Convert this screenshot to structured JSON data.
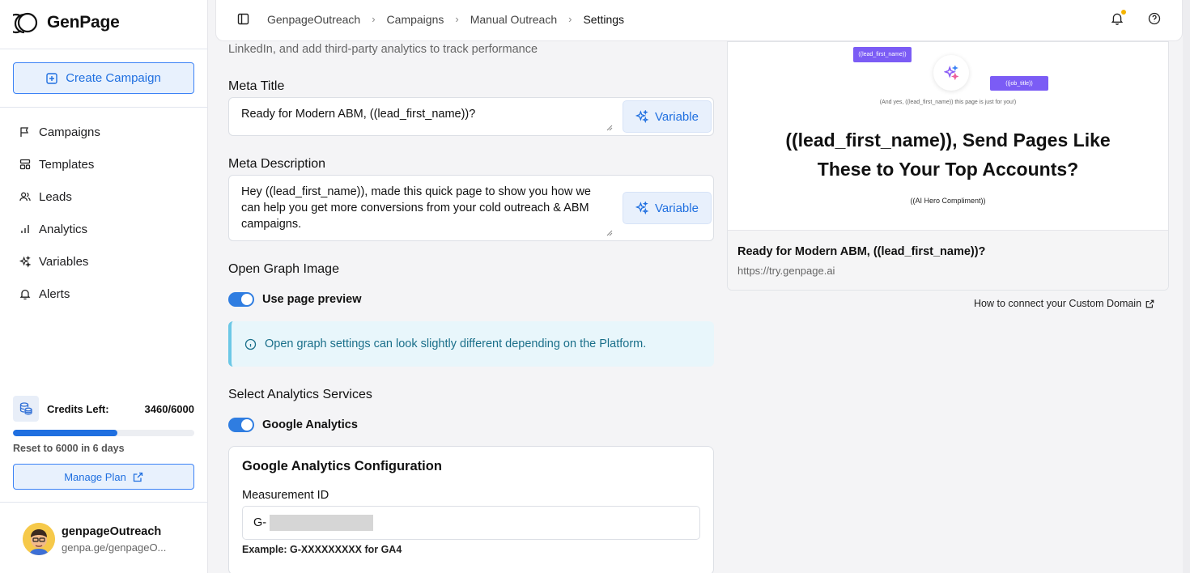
{
  "app": {
    "name": "GenPage"
  },
  "sidebar": {
    "create_label": "Create Campaign",
    "items": [
      {
        "label": "Campaigns",
        "icon": "flag-icon"
      },
      {
        "label": "Templates",
        "icon": "templates-icon"
      },
      {
        "label": "Leads",
        "icon": "users-icon"
      },
      {
        "label": "Analytics",
        "icon": "bar-chart-icon"
      },
      {
        "label": "Variables",
        "icon": "sparkles-icon"
      },
      {
        "label": "Alerts",
        "icon": "bell-icon"
      }
    ],
    "credits": {
      "label": "Credits Left:",
      "value": "3460/6000",
      "fraction": 0.577,
      "reset": "Reset to 6000 in 6 days"
    },
    "manage_label": "Manage Plan",
    "user": {
      "name": "genpageOutreach",
      "handle": "genpa.ge/genpageO..."
    }
  },
  "header": {
    "breadcrumbs": [
      "GenpageOutreach",
      "Campaigns",
      "Manual Outreach",
      "Settings"
    ],
    "icons": [
      "sidebar-toggle-icon",
      "bell-icon",
      "help-icon"
    ],
    "accent": "#1f6fe0"
  },
  "form": {
    "intro": "LinkedIn, and add third-party analytics to track performance",
    "meta_title": {
      "label": "Meta Title",
      "value": "Ready for Modern ABM, ((lead_first_name))?",
      "variable_label": "Variable"
    },
    "meta_description": {
      "label": "Meta Description",
      "value": "Hey ((lead_first_name)), made this quick page to show you how we can help you get more conversions from your cold outreach & ABM campaigns.",
      "variable_label": "Variable"
    },
    "og": {
      "label": "Open Graph Image",
      "toggle_label": "Use page preview",
      "info": "Open graph settings can look slightly different depending on the Platform."
    },
    "analytics": {
      "label": "Select Analytics Services",
      "toggle_label": "Google Analytics"
    },
    "ga": {
      "title": "Google Analytics Configuration",
      "field_label": "Measurement ID",
      "value": "G-",
      "example": "Example: G-XXXXXXXXX for GA4"
    }
  },
  "preview": {
    "tag_left": "((lead_first_name))",
    "tag_right": "((job_title))",
    "small_text": "(And yes, ((lead_first_name)) this page is just for you!)",
    "headline_1": "((lead_first_name)), Send Pages Like",
    "headline_2": "These to Your Top Accounts?",
    "compliment": "((AI Hero Compliment))",
    "title": "Ready for Modern ABM, ((lead_first_name))?",
    "url": "https://try.genpage.ai",
    "domain_link": "How to connect your Custom Domain"
  }
}
